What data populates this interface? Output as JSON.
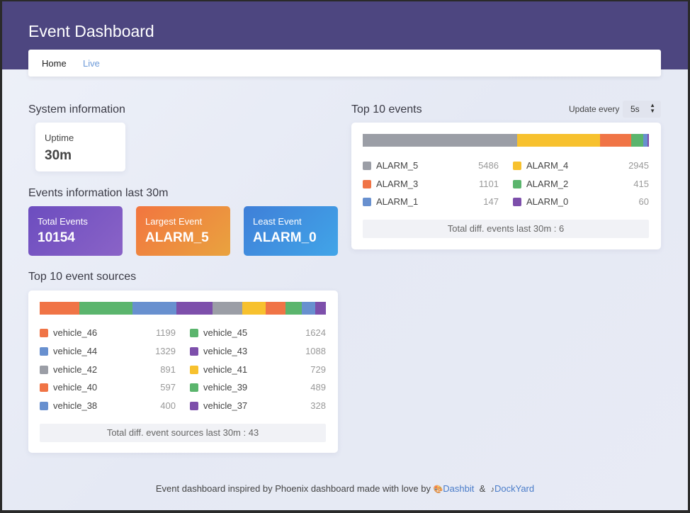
{
  "app": {
    "title": "Event Dashboard"
  },
  "nav": {
    "home": "Home",
    "live": "Live"
  },
  "system": {
    "title": "System information",
    "uptime_label": "Uptime",
    "uptime_value": "30m"
  },
  "events_info": {
    "title": "Events information last 30m",
    "total_label": "Total Events",
    "total_value": "10154",
    "largest_label": "Largest Event",
    "largest_value": "ALARM_5",
    "least_label": "Least Event",
    "least_value": "ALARM_0"
  },
  "colors": {
    "gray": "#9b9ea6",
    "yellow": "#f7c12e",
    "orange": "#f07446",
    "green": "#5bb56d",
    "blue": "#6890cf",
    "purple": "#7d4fab",
    "header": "#4d4680",
    "link": "#4a7cc9"
  },
  "top_events": {
    "title": "Top 10 events",
    "update_label": "Update every",
    "update_value": "5s",
    "items": [
      {
        "name": "ALARM_5",
        "count": "5486",
        "color": "#9b9ea6"
      },
      {
        "name": "ALARM_4",
        "count": "2945",
        "color": "#f7c12e"
      },
      {
        "name": "ALARM_3",
        "count": "1101",
        "color": "#f07446"
      },
      {
        "name": "ALARM_2",
        "count": "415",
        "color": "#5bb56d"
      },
      {
        "name": "ALARM_1",
        "count": "147",
        "color": "#6890cf"
      },
      {
        "name": "ALARM_0",
        "count": "60",
        "color": "#7d4fab"
      }
    ],
    "total": "Total diff. events last 30m : 6"
  },
  "top_sources": {
    "title": "Top 10 event sources",
    "items": [
      {
        "name": "vehicle_46",
        "count": "1199",
        "color": "#f07446"
      },
      {
        "name": "vehicle_45",
        "count": "1624",
        "color": "#5bb56d"
      },
      {
        "name": "vehicle_44",
        "count": "1329",
        "color": "#6890cf"
      },
      {
        "name": "vehicle_43",
        "count": "1088",
        "color": "#7d4fab"
      },
      {
        "name": "vehicle_42",
        "count": "891",
        "color": "#9b9ea6"
      },
      {
        "name": "vehicle_41",
        "count": "729",
        "color": "#f7c12e"
      },
      {
        "name": "vehicle_40",
        "count": "597",
        "color": "#f07446"
      },
      {
        "name": "vehicle_39",
        "count": "489",
        "color": "#5bb56d"
      },
      {
        "name": "vehicle_38",
        "count": "400",
        "color": "#6890cf"
      },
      {
        "name": "vehicle_37",
        "count": "328",
        "color": "#7d4fab"
      }
    ],
    "total": "Total diff. event sources last 30m : 43"
  },
  "footer": {
    "text": "Event dashboard inspired by Phoenix dashboard made with love by",
    "link1": "Dashbit",
    "amp": "&",
    "link2": "DockYard"
  }
}
